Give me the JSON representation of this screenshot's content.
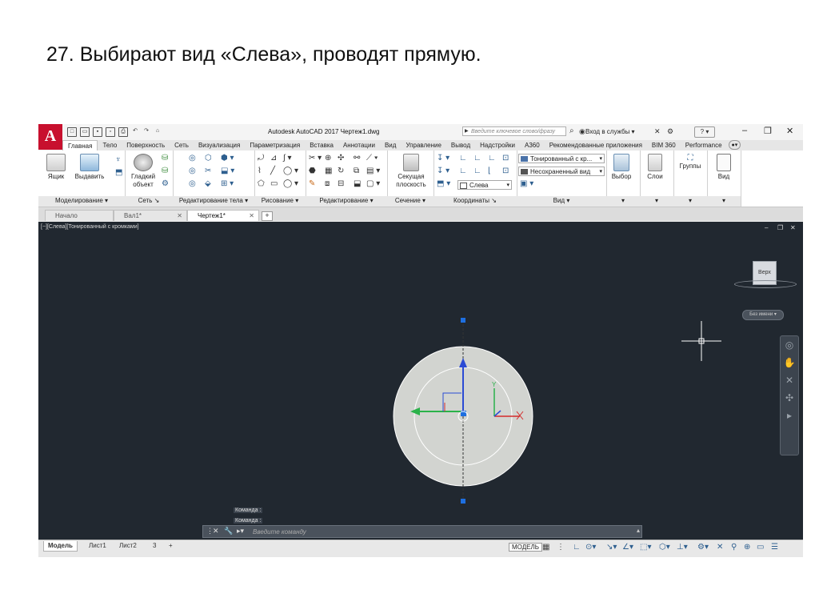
{
  "slide": {
    "title": "27. Выбирают вид «Слева», проводят прямую."
  },
  "app": {
    "logo": "A",
    "window_title": "Autodesk AutoCAD 2017   Чертеж1.dwg",
    "search_placeholder": "Введите ключевое слово/фразу",
    "signin": "Вход в службы",
    "help": "?"
  },
  "ribbon_tabs": [
    "Главная",
    "Тело",
    "Поверхность",
    "Сеть",
    "Визуализация",
    "Параметризация",
    "Вставка",
    "Аннотации",
    "Вид",
    "Управление",
    "Вывод",
    "Надстройки",
    "A360",
    "Рекомендованные приложения",
    "BIM 360",
    "Performance"
  ],
  "ribbon": {
    "tools": {
      "box": "Ящик",
      "extrude": "Выдавить",
      "smooth": "Гладкий объект",
      "section": "Секущая плоскость",
      "select": "Выбор",
      "layers": "Слои",
      "groups": "Группы",
      "view": "Вид"
    },
    "dropdowns": {
      "visual_style": "Тонированный с кр...",
      "saved_view": "Несохраненный вид",
      "ucs_view": "Слева"
    },
    "panels": [
      "Моделирование",
      "Сеть",
      "Редактирование тела",
      "Рисование",
      "Редактирование",
      "Сечение",
      "Координаты",
      "Вид"
    ]
  },
  "file_tabs": [
    {
      "label": "Начало"
    },
    {
      "label": "Вал1*"
    },
    {
      "label": "Чертеж1*"
    }
  ],
  "viewport": {
    "label": "[−][Слева][Тонированный с кромками]",
    "viewcube_face": "Верх",
    "wcs_label": "Без имени",
    "axis_y": "Y",
    "command_history": [
      "Команда :",
      "Команда :"
    ],
    "command_placeholder": "Введите команду"
  },
  "layout_tabs": [
    "Модель",
    "Лист1",
    "Лист2",
    "3"
  ],
  "status": {
    "model": "МОДЕЛЬ"
  },
  "colors": {
    "viewport_bg": "#212830",
    "disc_fill": "#d2d4d0",
    "axis_x": "#d42b2b",
    "axis_y_green": "#2bb24a",
    "axis_z": "#2b4bd4",
    "grip": "#1e6fe0"
  },
  "icons": [
    "search-icon",
    "gear-icon",
    "close-icon",
    "plus-icon",
    "layers-icon",
    "crosshair-icon"
  ]
}
